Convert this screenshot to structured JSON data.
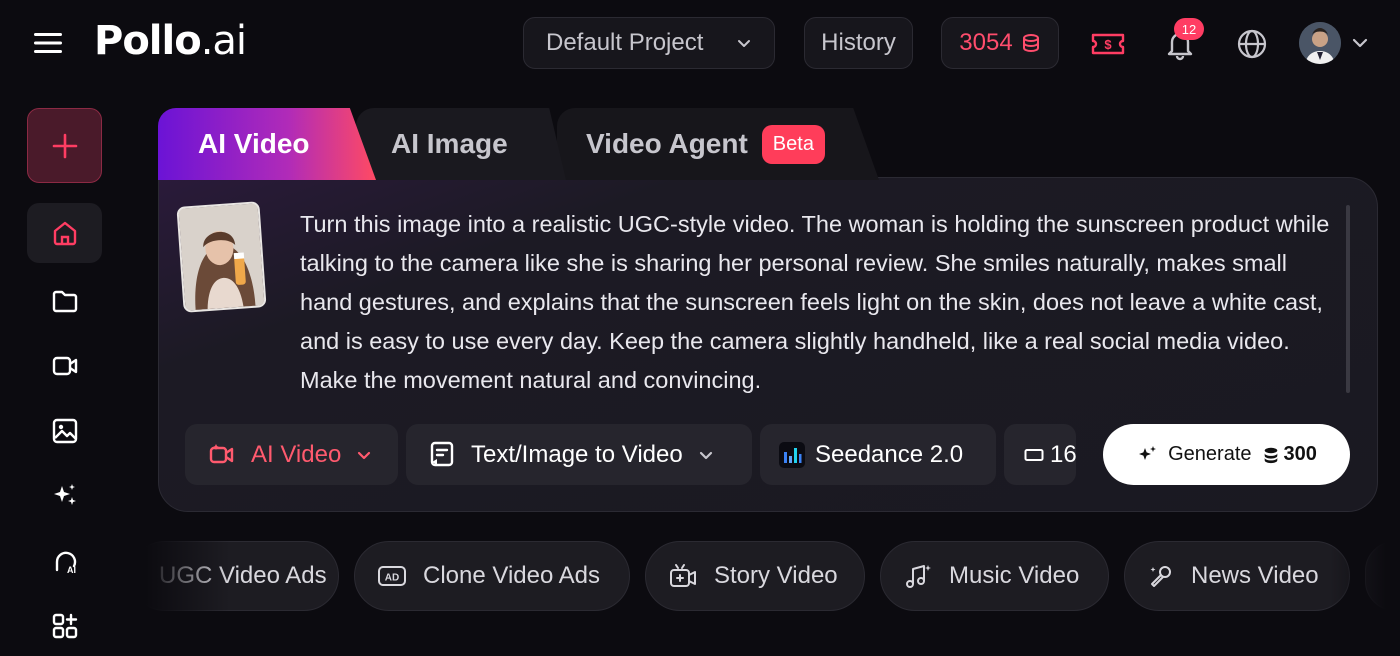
{
  "header": {
    "logo_main": "Pollo",
    "logo_suffix": ".ai",
    "project_label": "Default Project",
    "history_label": "History",
    "credits": "3054",
    "notification_count": "12"
  },
  "tabs": [
    {
      "label": "AI Video",
      "active": true
    },
    {
      "label": "AI Image",
      "active": false
    },
    {
      "label": "Video Agent",
      "badge": "Beta",
      "active": false
    }
  ],
  "prompt": {
    "text": "Turn this image into a realistic UGC-style video. The woman is holding the sunscreen product while talking to the camera like she is sharing her personal review. She smiles naturally, makes small hand gestures, and explains that the sunscreen feels light on the skin, does not leave a white cast, and is easy to use every day. Keep the camera slightly handheld, like a real social media video. Make the movement natural and convincing."
  },
  "toolbar": {
    "type_label": "AI Video",
    "mode_label": "Text/Image to Video",
    "model_label": "Seedance 2.0",
    "ratio_label": "16",
    "generate_label": "Generate",
    "generate_cost": "300"
  },
  "chips": [
    {
      "label": "UGC Video Ads",
      "icon": "ugc-icon"
    },
    {
      "label": "Clone Video Ads",
      "icon": "ad-icon"
    },
    {
      "label": "Story Video",
      "icon": "story-video-icon"
    },
    {
      "label": "Music Video",
      "icon": "music-icon"
    },
    {
      "label": "News Video",
      "icon": "news-mic-icon"
    }
  ],
  "colors": {
    "accent": "#ff3d63",
    "background": "#0c0b10",
    "card": "#1a1921",
    "tab_gradient_start": "#6b13d6",
    "tab_gradient_end": "#ff4a63"
  }
}
